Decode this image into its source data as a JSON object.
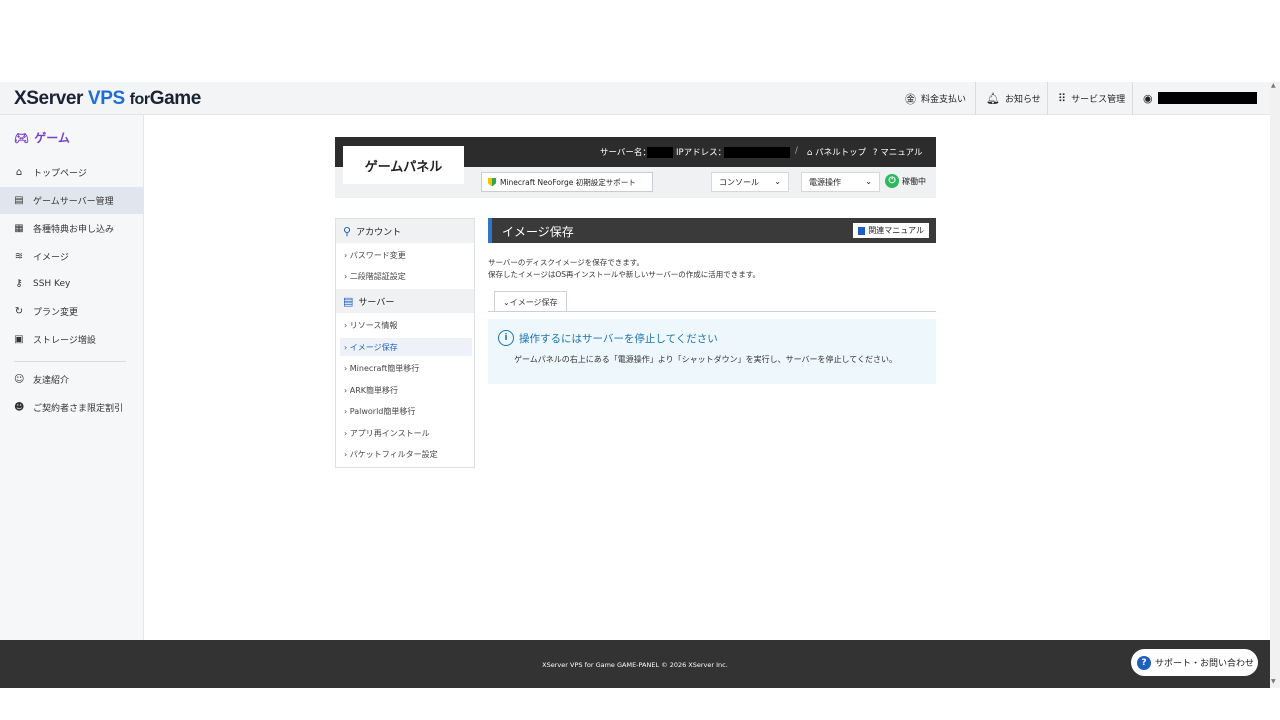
{
  "header": {
    "brand": {
      "part1": "XServer ",
      "part2": "VPS ",
      "part3": "for",
      "part4": "Game"
    },
    "nav": {
      "billing": "料金支払い",
      "notices": "お知らせ",
      "services": "サービス管理"
    }
  },
  "sidebar": {
    "title": "ゲーム",
    "items": [
      {
        "label": "トップページ",
        "icon": "home-icon"
      },
      {
        "label": "ゲームサーバー管理",
        "icon": "server-icon"
      },
      {
        "label": "各種特典お申し込み",
        "icon": "gift-icon"
      },
      {
        "label": "イメージ",
        "icon": "layers-icon"
      },
      {
        "label": "SSH Key",
        "icon": "key-icon"
      },
      {
        "label": "プラン変更",
        "icon": "refresh-icon"
      },
      {
        "label": "ストレージ増設",
        "icon": "storage-icon"
      },
      {
        "label": "友達紹介",
        "icon": "friend-icon"
      },
      {
        "label": "ご契約者さま限定割引",
        "icon": "member-icon"
      }
    ]
  },
  "panel": {
    "logo": "ゲームパネル",
    "server_name_label": "サーバー名：",
    "ip_label": "IPアドレス：",
    "separator": "/",
    "panel_top": "パネルトップ",
    "manual": "マニュアル",
    "neoforge_button": "Minecraft NeoForge 初期設定サポート",
    "console_select": "コンソール",
    "power_select": "電源操作",
    "status": "稼働中"
  },
  "menu": {
    "account_heading": "アカウント",
    "account_items": [
      "パスワード変更",
      "二段階認証設定"
    ],
    "server_heading": "サーバー",
    "server_items": [
      "リソース情報",
      "イメージ保存",
      "Minecraft簡単移行",
      "ARK簡単移行",
      "Palworld簡単移行",
      "アプリ再インストール",
      "パケットフィルター設定"
    ]
  },
  "main": {
    "title": "イメージ保存",
    "manual_button": "関連マニュアル",
    "desc1": "サーバーのディスクイメージを保存できます。",
    "desc2": "保存したイメージはOS再インストールや新しいサーバーの作成に活用できます。",
    "tab": "イメージ保存",
    "notice_title": "操作するにはサーバーを停止してください",
    "notice_body": "ゲームパネルの右上にある「電源操作」より「シャットダウン」を実行し、サーバーを停止してください。"
  },
  "footer": {
    "copyright": "XServer VPS for Game GAME-PANEL © 2026 XServer Inc.",
    "support": "サポート・お問い合わせ"
  },
  "colors": {
    "accent": "#1f5fbf",
    "sidebar_title": "#7b3fd0",
    "status_green": "#2eb85c"
  }
}
